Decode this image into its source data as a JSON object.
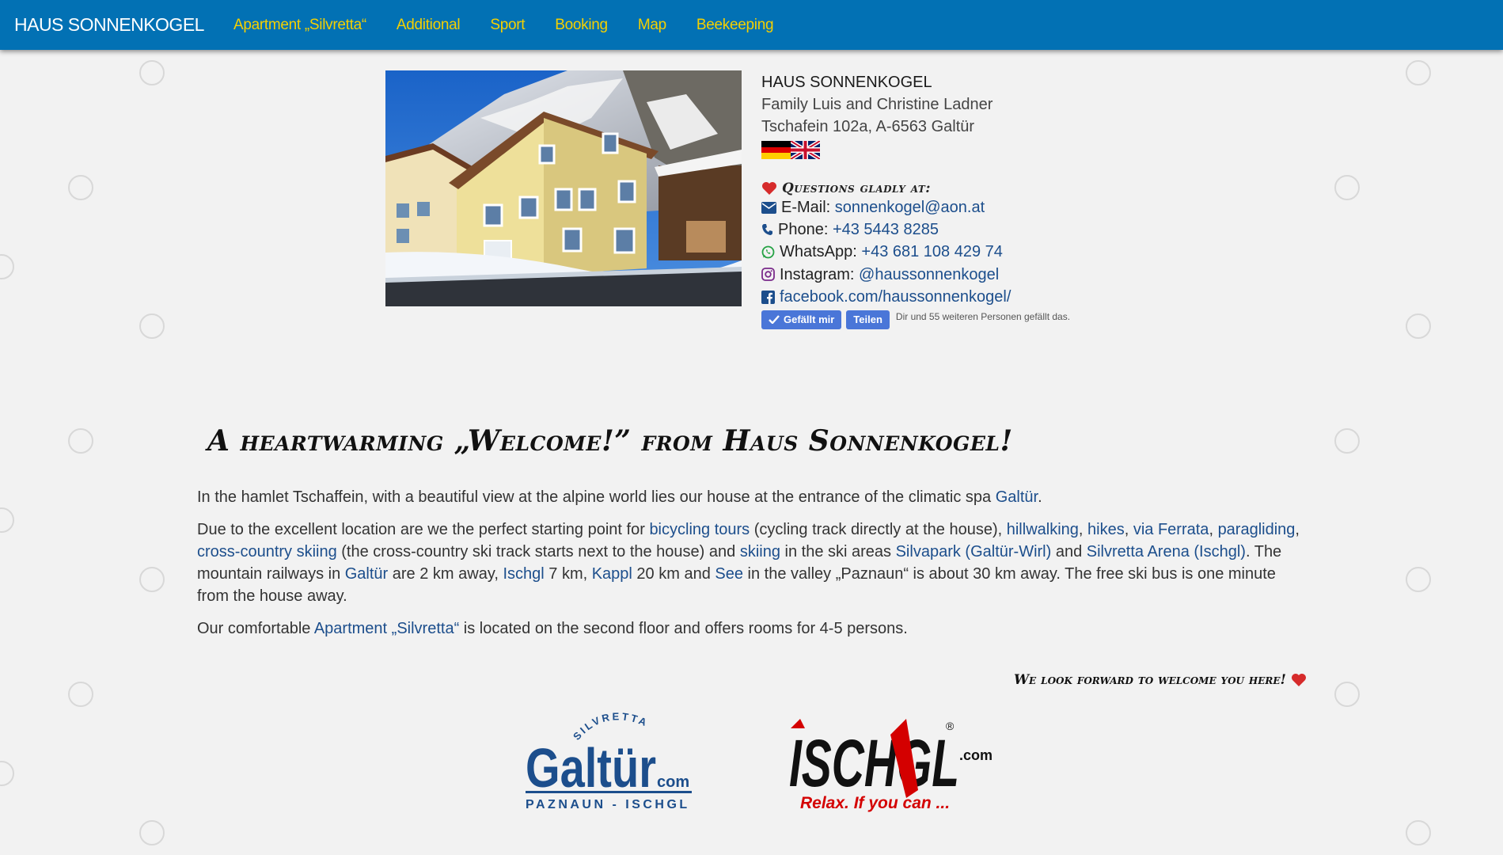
{
  "nav": {
    "brand": "HAUS SONNENKOGEL",
    "items": [
      {
        "label": "Apartment „Silvretta“"
      },
      {
        "label": "Additional"
      },
      {
        "label": "Sport"
      },
      {
        "label": "Booking"
      },
      {
        "label": "Map"
      },
      {
        "label": "Beekeeping"
      }
    ]
  },
  "contact": {
    "name": "HAUS SONNENKOGEL",
    "family": "Family Luis and Christine Ladner",
    "address": "Tschafein 102a, A-6563 Galtür",
    "questions_heading": "Questions gladly at:",
    "email_label": "E-Mail:",
    "email": "sonnenkogel@aon.at",
    "phone_label": "Phone:",
    "phone": "+43 5443 8285",
    "whatsapp_label": "WhatsApp:",
    "whatsapp": "+43 681 108 429 74",
    "instagram_label": "Instagram:",
    "instagram": "@haussonnenkogel",
    "facebook": "facebook.com/haussonnenkogel/",
    "fb_like": "Gefällt mir",
    "fb_share": "Teilen",
    "fb_text": "Dir und 55 weiteren Personen gefällt das."
  },
  "welcome": {
    "title": "A heartwarming „Welcome!” from Haus Sonnenkogel!",
    "p1_a": "In the hamlet Tschaffein, with a beautiful view at the alpine world lies our house at the entrance of the climatic spa ",
    "p1_link": "Galtür",
    "p1_b": ".",
    "p2": {
      "t1": "Due to the excellent location are we the perfect starting point for ",
      "l1": "bicycling tours",
      "t2": " (cycling track directly at the house), ",
      "l2": "hillwalking",
      "t3": ", ",
      "l3": "hikes",
      "t4": ", ",
      "l4": "via Ferrata",
      "t5": ", ",
      "l5": "paragliding",
      "t6": ", ",
      "l6": "cross-country skiing",
      "t7": " (the cross-country ski track starts next to the house) and ",
      "l7": "skiing",
      "t8": " in the ski areas ",
      "l8": "Silvapark (Galtür-Wirl)",
      "t9": " and ",
      "l9": "Silvretta Arena (Ischgl)",
      "t10": ". The mountain railways in ",
      "l10": "Galtür",
      "t11": " are 2 km away, ",
      "l11": "Ischgl",
      "t12": " 7 km, ",
      "l12": "Kappl",
      "t13": " 20 km and ",
      "l13": "See",
      "t14": " in the valley „Paznaun“ is about 30 km away. The free ski bus is one minute from the house away."
    },
    "p3_a": "Our comfortable ",
    "p3_link": "Apartment „Silvretta“",
    "p3_b": " is located on the second floor and offers rooms for 4-5 persons.",
    "lookforward": "We look forward to welcome you here!"
  },
  "logos": {
    "galtur": {
      "arc": "SILVRETTA",
      "name": "Galtür",
      "com": "com",
      "sub": "PAZNAUN - ISCHGL"
    },
    "ischgl": {
      "name": "ISCHGL",
      "com": ".com",
      "reg": "®",
      "slogan": "Relax. If you can ..."
    }
  },
  "colors": {
    "navbar": "#0271b4",
    "nav_link": "#f5d000",
    "link": "#1c4e8c",
    "heart": "#d62b2b",
    "background": "#f2f2f2"
  },
  "icons": [
    "heart-icon",
    "envelope-icon",
    "phone-icon",
    "whatsapp-icon",
    "instagram-icon",
    "facebook-icon",
    "flag-de-icon",
    "flag-en-icon"
  ]
}
